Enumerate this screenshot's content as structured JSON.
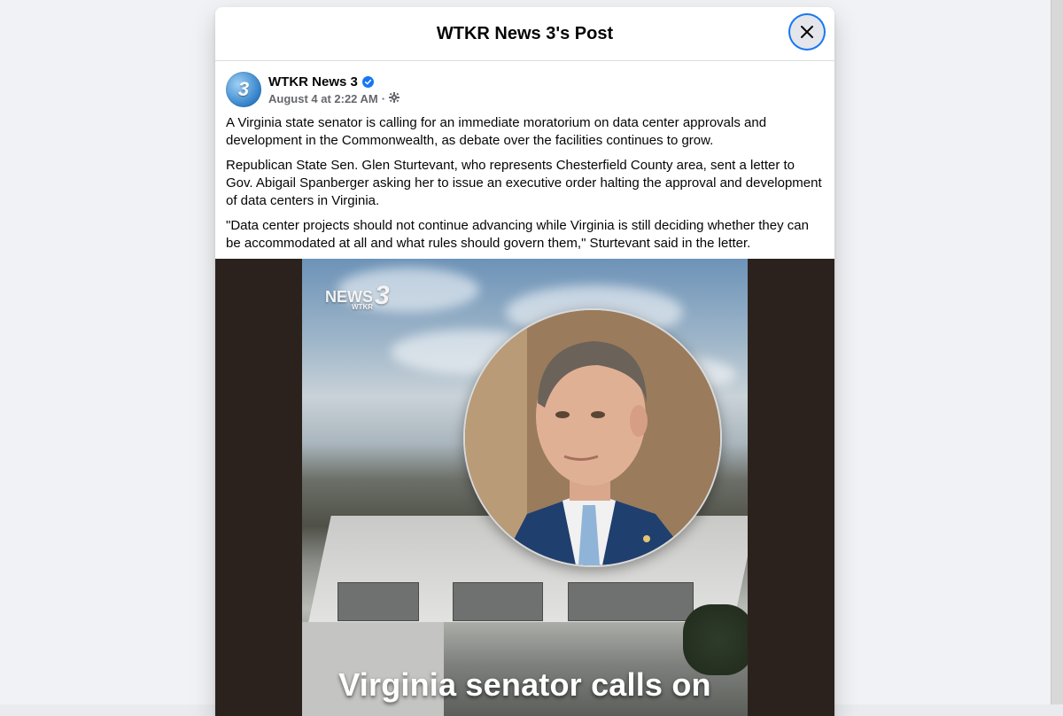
{
  "dialog": {
    "title": "WTKR News 3's Post"
  },
  "post": {
    "page_name": "WTKR News 3",
    "timestamp": "August 4 at 2:22 AM",
    "separator": "·",
    "avatar_text": "3",
    "paragraphs": [
      "A Virginia state senator is calling for an immediate moratorium on data center approvals and development in the Commonwealth, as debate over the facilities continues to grow.",
      "Republican State Sen. Glen Sturtevant, who represents Chesterfield County area, sent a letter to Gov. Abigail Spanberger asking her to issue an executive order halting the approval and development of data centers in Virginia.",
      "\"Data center projects should not continue advancing while Virginia is still deciding whether they can be accommodated at all and what rules should govern them,\" Sturtevant said in the letter."
    ]
  },
  "media": {
    "logo_text": "NEWS",
    "logo_number": "3",
    "logo_sub": "WTKR",
    "headline": "Virginia senator calls on"
  },
  "colors": {
    "accent": "#1877f2",
    "verified": "#1877f2",
    "media_bg": "#2c221d"
  },
  "icons": {
    "close": "close-icon",
    "verified": "verified-badge-icon",
    "audience": "gear-icon"
  }
}
